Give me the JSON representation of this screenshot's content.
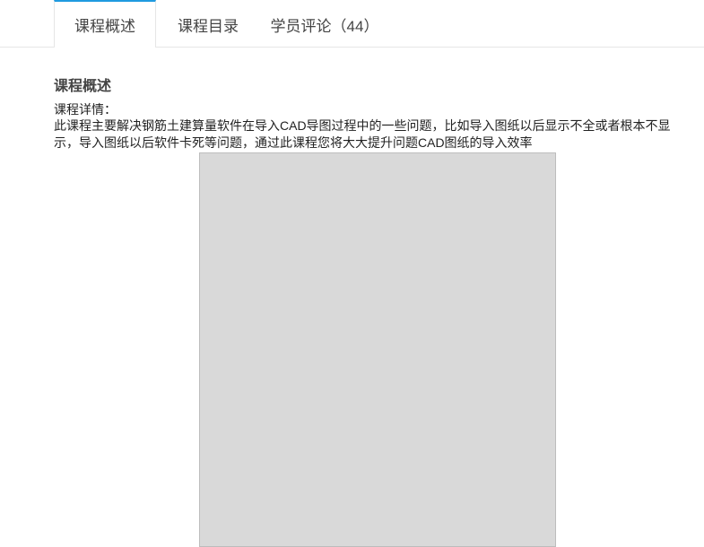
{
  "tabs": [
    {
      "label": "课程概述",
      "active": true
    },
    {
      "label": "课程目录",
      "active": false
    },
    {
      "label": "学员评论（44）",
      "active": false
    }
  ],
  "section": {
    "title": "课程概述",
    "detail_label": "课程详情：",
    "description": "此课程主要解决钢筋土建算量软件在导入CAD导图过程中的一些问题，比如导入图纸以后显示不全或者根本不显示，导入图纸以后软件卡死等问题，通过此课程您将大大提升问题CAD图纸的导入效率"
  }
}
